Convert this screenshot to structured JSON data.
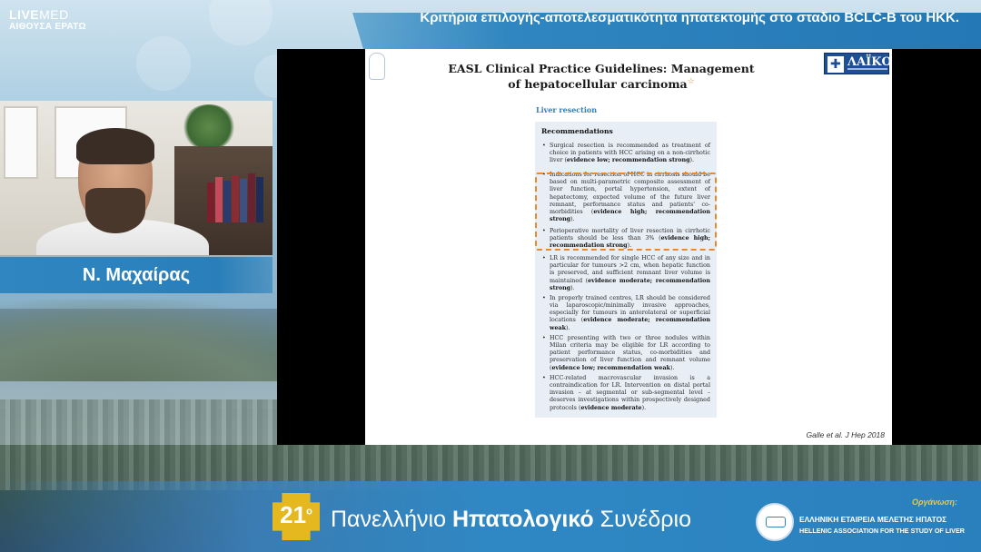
{
  "header": {
    "brand_bold": "LIVE",
    "brand_light": "MED",
    "room": "ΑΙΘΟΥΣΑ ΕΡΑΤΩ",
    "title": "Κριτήρια επιλογής-αποτελεσματικότητα ηπατεκτομής στο σταδιο BCLC-B του ΗΚΚ."
  },
  "speaker": {
    "name": "Ν. Μαχαίρας"
  },
  "slide": {
    "hospital_logo": "ΛΑΪΚΟ",
    "paper_title_line1": "EASL Clinical Practice Guidelines: Management",
    "paper_title_line2": "of hepatocellular carcinoma",
    "paper_title_mark": "☆",
    "section": "Liver resection",
    "recommendations_heading": "Recommendations",
    "recommendations": [
      {
        "text": "Surgical resection is recommended as treatment of choice in patients with HCC arising on a non-cirrhotic liver (",
        "bold": "evidence low; recommendation strong",
        "tail": ")."
      },
      {
        "text": "Indications for resection of HCC in cirrhosis should be based on multi-parametric composite assessment of liver function, portal hypertension, extent of hepatectomy, expected volume of the future liver remnant, performance status and patients' co-morbidities (",
        "bold": "evidence high; recommendation strong",
        "tail": ")."
      },
      {
        "text": "Perioperative mortality of liver resection in cirrhotic patients should be less than 3% (",
        "bold": "evidence high; recommendation strong",
        "tail": ")."
      },
      {
        "text": "LR is recommended for single HCC of any size and in particular for tumours >2 cm, when hepatic function is preserved, and sufficient remnant liver volume is maintained (",
        "bold": "evidence moderate; recommendation strong",
        "tail": ")."
      },
      {
        "text": "In properly trained centres, LR should be considered via laparoscopic/minimally invasive approaches, especially for tumours in anterolateral or superficial locations (",
        "bold": "evidence moderate; recommendation weak",
        "tail": ")."
      },
      {
        "text": "HCC presenting with two or three nodules within Milan criteria may be eligible for LR according to patient performance status, co-morbidities and preservation of liver function and remnant volume (",
        "bold": "evidence low; recommendation weak",
        "tail": ")."
      },
      {
        "text": "HCC-related macrovascular invasion is a contraindication for LR. Intervention on distal portal invasion – at segmental or sub-segmental level – deserves investigations within prospectively designed protocols (",
        "bold": "evidence moderate",
        "tail": ")."
      }
    ],
    "citation": "Galle et al. J Hep 2018"
  },
  "footer": {
    "edition": "21",
    "edition_suffix": "ο",
    "congress_prefix": "Πανελλήνιο ",
    "congress_bold": "Ηπατολογικό",
    "congress_suffix": " Συνέδριο",
    "organizer_label": "Οργάνωση:",
    "organizer_gr": "ΕΛΛΗΝΙΚΗ ΕΤΑΙΡΕΙΑ ΜΕΛΕΤΗΣ ΗΠΑΤΟΣ",
    "organizer_en": "HELLENIC ASSOCIATION FOR THE STUDY OF LIVER"
  },
  "colors": {
    "accent_blue": "#2f86c0",
    "highlight_orange": "#e88a2a",
    "badge_yellow": "#e5b81f"
  }
}
